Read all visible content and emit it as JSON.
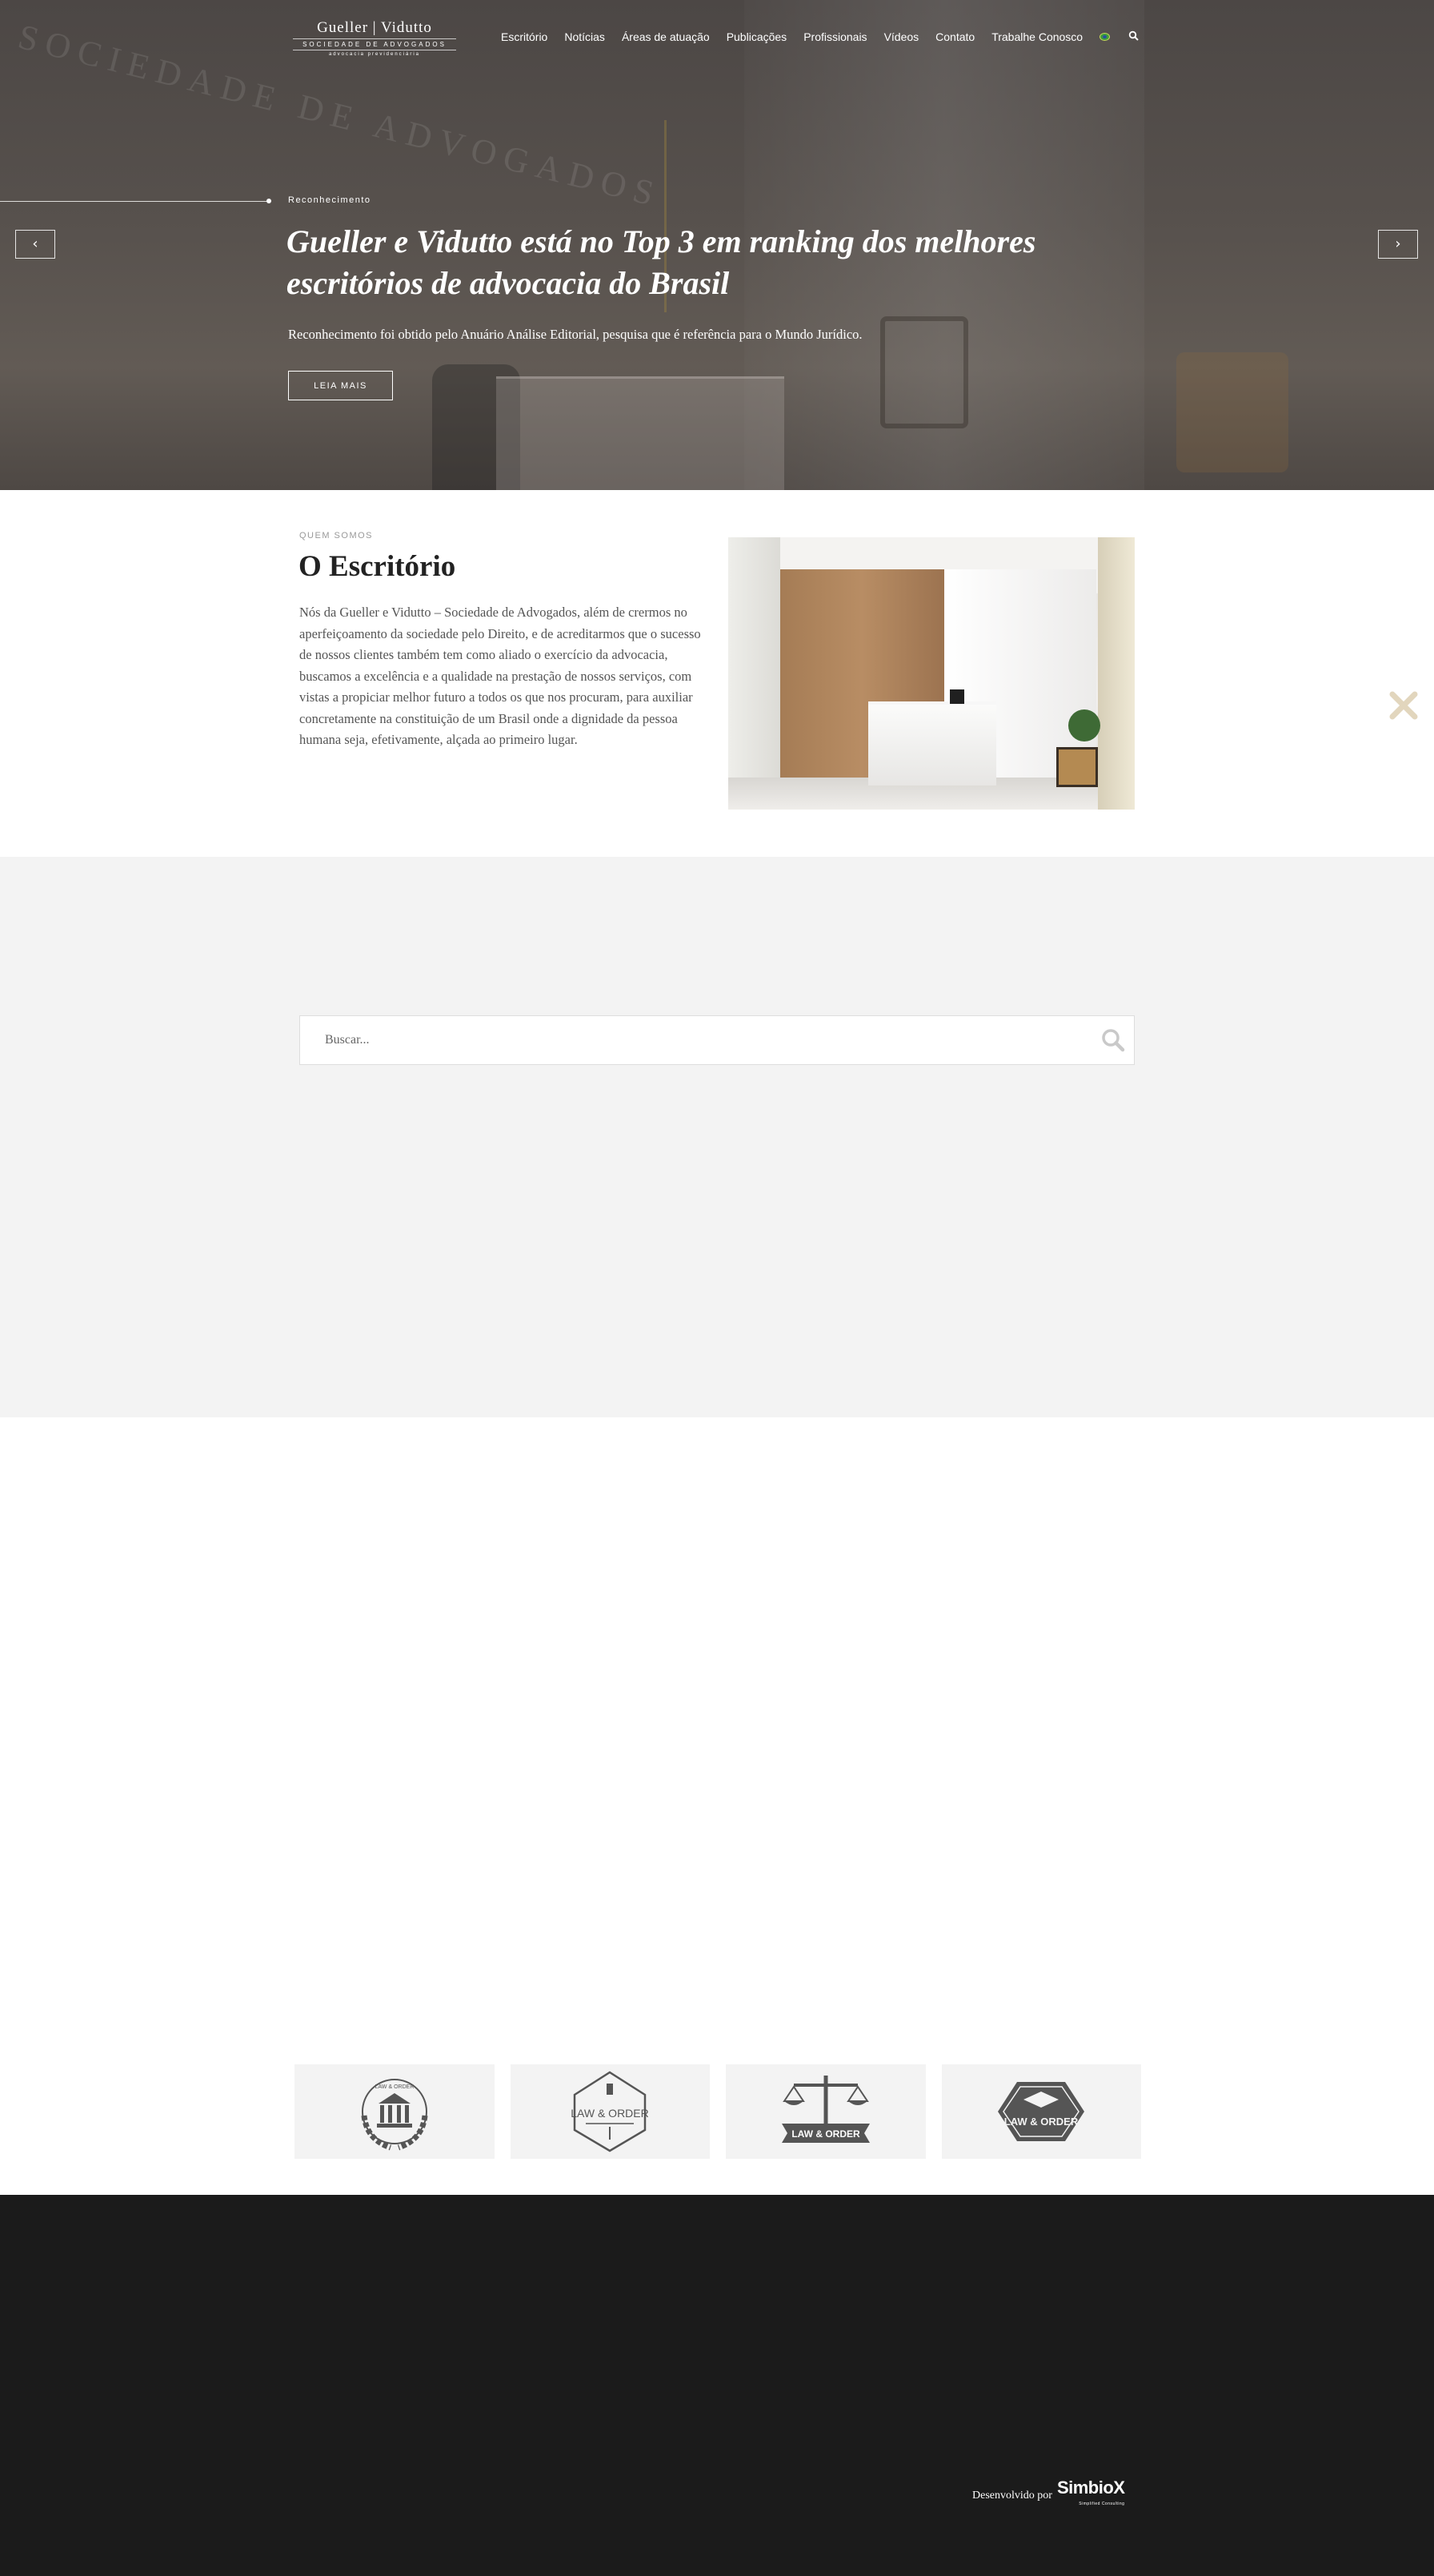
{
  "header": {
    "logo": {
      "name": "Gueller | Vidutto",
      "subtitle": "SOCIEDADE DE ADVOGADOS",
      "tagline": "advocacia previdenciária"
    },
    "nav_items": [
      "Escritório",
      "Notícias",
      "Áreas de atuação",
      "Publicações",
      "Profissionais",
      "Vídeos",
      "Contato",
      "Trabalhe Conosco"
    ],
    "language_flag": "brazil-flag-icon"
  },
  "hero": {
    "kicker": "Reconhecimento",
    "title": "Gueller e Vidutto está no Top 3 em ranking dos melhores escritórios de advocacia do Brasil",
    "description": "Reconhecimento foi obtido pelo Anuário Análise Editorial, pesquisa que é referência para o Mundo Jurídico.",
    "button_label": "LEIA MAIS",
    "prev_arrow": "‹",
    "next_arrow": "›",
    "background_wall_text": "SOCIEDADE DE ADVOGADOS"
  },
  "about": {
    "kicker": "QUEM SOMOS",
    "title": "O Escritório",
    "text": "Nós da Gueller e Vidutto – Sociedade de Advogados, além de crermos no aperfeiçoamento da sociedade pelo Direito, e de acreditarmos que o sucesso de nossos clientes também tem como aliado o exercício da advocacia, buscamos a excelência e a qualidade na prestação de nossos serviços, com vistas a propiciar melhor futuro a todos os que nos procuram, para auxiliar concretamente na constituição de um Brasil onde a dignidade da pessoa humana seja, efetivamente, alçada ao primeiro lugar."
  },
  "search": {
    "placeholder": "Buscar..."
  },
  "partner_logos": [
    {
      "text": "LAW & ORDER",
      "icon": "courthouse-laurel-icon"
    },
    {
      "text": "LAW & ORDER",
      "icon": "column-badge-icon"
    },
    {
      "text": "LAW & ORDER",
      "icon": "scales-of-justice-icon"
    },
    {
      "text": "LAW & ORDER",
      "icon": "graduation-cap-badge-icon"
    }
  ],
  "footer": {
    "credit_label": "Desenvolvido por",
    "credit_brand": "SimbioX",
    "credit_tag": "Simplified Consulting"
  },
  "colors": {
    "hero_overlay": "#4f4945",
    "gray_band": "#f3f3f3",
    "footer_bg": "#1b1b1b",
    "close_icon": "#e2d6bd"
  }
}
